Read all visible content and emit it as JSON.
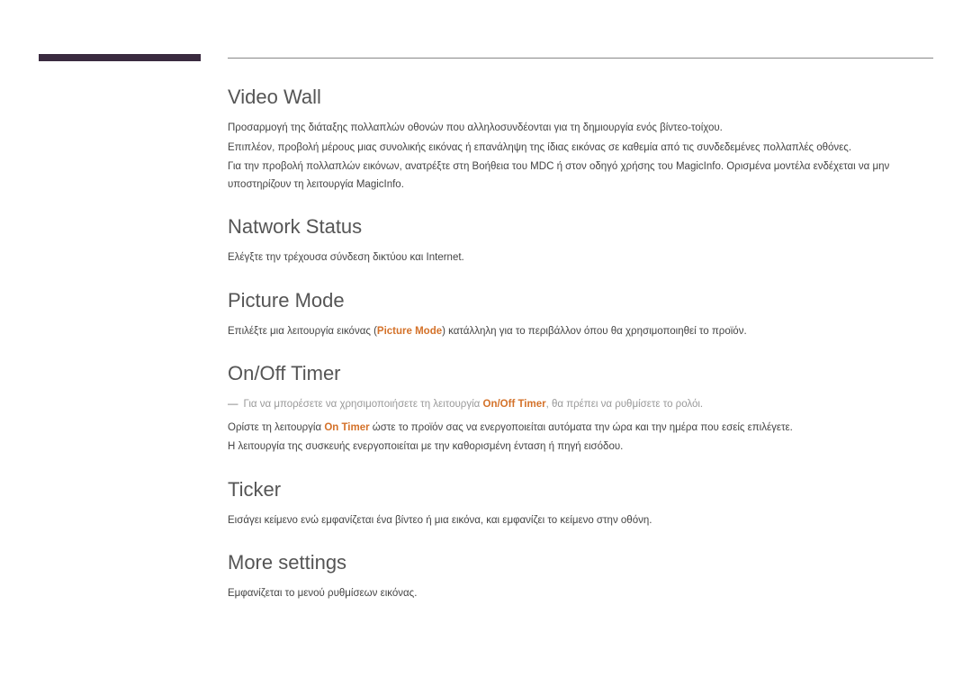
{
  "sections": {
    "videoWall": {
      "title": "Video Wall",
      "p1": "Προσαρμογή της διάταξης πολλαπλών οθονών που αλληλοσυνδέονται για τη δημιουργία ενός βίντεο-τοίχου.",
      "p2": "Επιπλέον, προβολή μέρους μιας συνολικής εικόνας ή επανάληψη της ίδιας εικόνας σε καθεμία από τις συνδεδεμένες πολλαπλές οθόνες.",
      "p3": "Για την προβολή πολλαπλών εικόνων, ανατρέξτε στη Βοήθεια του MDC ή στον οδηγό χρήσης του MagicInfo. Ορισμένα μοντέλα ενδέχεται να μην υποστηρίζουν τη λειτουργία MagicInfo."
    },
    "networkStatus": {
      "title": "Natwork Status",
      "p1": "Ελέγξτε την τρέχουσα σύνδεση δικτύου και Internet."
    },
    "pictureMode": {
      "title": "Picture Mode",
      "p1a": "Επιλέξτε μια λειτουργία εικόνας (",
      "p1h": "Picture Mode",
      "p1b": ") κατάλληλη για το περιβάλλον όπου θα χρησιμοποιηθεί το προϊόν."
    },
    "onOffTimer": {
      "title": "On/Off Timer",
      "noteA": "Για να μπορέσετε να χρησιμοποιήσετε τη λειτουργία ",
      "noteH": "On/Off Timer",
      "noteB": ", θα πρέπει να ρυθμίσετε το ρολόι.",
      "p1a": "Ορίστε τη λειτουργία ",
      "p1h": "On Timer",
      "p1b": " ώστε το προϊόν σας να ενεργοποιείται αυτόματα την ώρα και την ημέρα που εσείς επιλέγετε.",
      "p2": "Η λειτουργία της συσκευής ενεργοποιείται με την καθορισμένη ένταση ή πηγή εισόδου."
    },
    "ticker": {
      "title": "Ticker",
      "p1": "Εισάγει κείμενο ενώ εμφανίζεται ένα βίντεο ή μια εικόνα, και εμφανίζει το κείμενο στην οθόνη."
    },
    "moreSettings": {
      "title": "More settings",
      "p1": "Εμφανίζεται το μενού ρυθμίσεων εικόνας."
    }
  }
}
